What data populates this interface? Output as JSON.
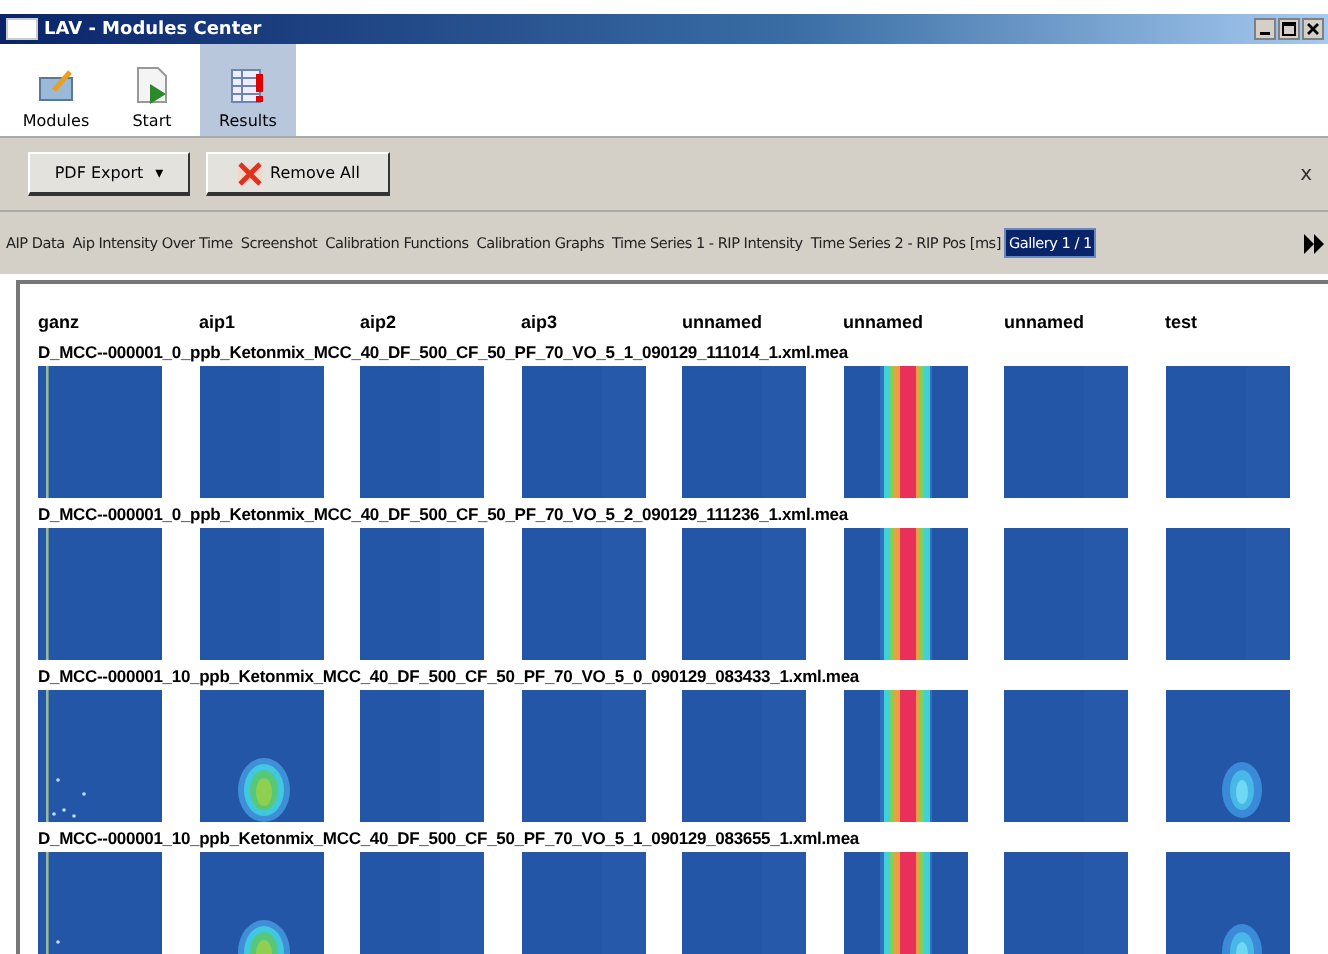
{
  "window": {
    "title": "LAV - Modules Center"
  },
  "ribbon": [
    {
      "label": "Modules",
      "kind": "modules",
      "selected": false
    },
    {
      "label": "Start",
      "kind": "start",
      "selected": false
    },
    {
      "label": "Results",
      "kind": "results",
      "selected": true
    }
  ],
  "toolbar": {
    "pdf_export": "PDF Export",
    "caret": "▾",
    "remove_all": "Remove All",
    "close": "x"
  },
  "tabs": [
    {
      "label": "AIP Data",
      "selected": false
    },
    {
      "label": "Aip Intensity Over Time",
      "selected": false
    },
    {
      "label": "Screenshot",
      "selected": false
    },
    {
      "label": "Calibration Functions",
      "selected": false
    },
    {
      "label": "Calibration Graphs",
      "selected": false
    },
    {
      "label": "Time Series 1 - RIP Intensity",
      "selected": false
    },
    {
      "label": "Time Series 2 - RIP Pos [ms]",
      "selected": false
    },
    {
      "label": "Gallery 1 / 1",
      "selected": true
    }
  ],
  "gallery": {
    "columns": [
      "ganz",
      "aip1",
      "aip2",
      "aip3",
      "unnamed",
      "unnamed",
      "unnamed",
      "test"
    ],
    "rows": [
      {
        "file": "D_MCC--000001_0_ppb_Ketonmix_MCC_40_DF_500_CF_50_PF_70_VO_5_1_090129_111014_1.xml.mea",
        "cells": [
          {
            "kind": "line"
          },
          {
            "kind": "flat"
          },
          {
            "kind": "flat"
          },
          {
            "kind": "flat"
          },
          {
            "kind": "flat"
          },
          {
            "kind": "stripes"
          },
          {
            "kind": "flat"
          },
          {
            "kind": "flat"
          }
        ]
      },
      {
        "file": "D_MCC--000001_0_ppb_Ketonmix_MCC_40_DF_500_CF_50_PF_70_VO_5_2_090129_111236_1.xml.mea",
        "cells": [
          {
            "kind": "line"
          },
          {
            "kind": "flat"
          },
          {
            "kind": "flat"
          },
          {
            "kind": "flat"
          },
          {
            "kind": "flat"
          },
          {
            "kind": "stripes"
          },
          {
            "kind": "flat"
          },
          {
            "kind": "flat"
          }
        ]
      },
      {
        "file": "D_MCC--000001_10_ppb_Ketonmix_MCC_40_DF_500_CF_50_PF_70_VO_5_0_090129_083433_1.xml.mea",
        "cells": [
          {
            "kind": "dots"
          },
          {
            "kind": "blob"
          },
          {
            "kind": "flat"
          },
          {
            "kind": "flat"
          },
          {
            "kind": "flat"
          },
          {
            "kind": "stripes"
          },
          {
            "kind": "flat"
          },
          {
            "kind": "faint-blob"
          }
        ]
      },
      {
        "file": "D_MCC--000001_10_ppb_Ketonmix_MCC_40_DF_500_CF_50_PF_70_VO_5_1_090129_083655_1.xml.mea",
        "cells": [
          {
            "kind": "dots"
          },
          {
            "kind": "blob"
          },
          {
            "kind": "flat"
          },
          {
            "kind": "flat"
          },
          {
            "kind": "flat"
          },
          {
            "kind": "stripes"
          },
          {
            "kind": "flat"
          },
          {
            "kind": "faint-blob"
          }
        ]
      }
    ]
  }
}
